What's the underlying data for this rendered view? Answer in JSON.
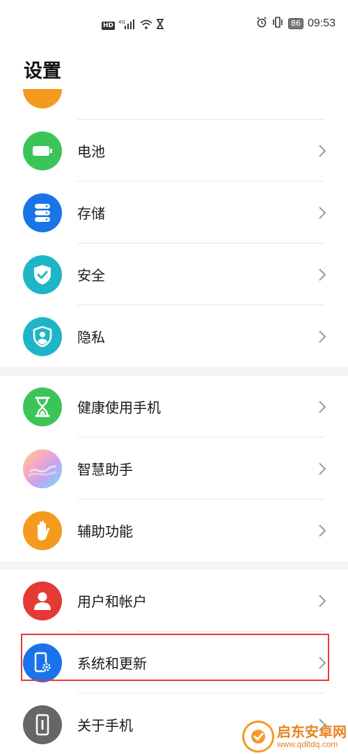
{
  "status_bar": {
    "hd": "HD",
    "network": "4G",
    "battery": "86",
    "time": "09:53"
  },
  "page_title": "设置",
  "items": [
    {
      "label": "",
      "icon": "storage-partial-icon",
      "color": "#f39a1f"
    },
    {
      "label": "电池",
      "icon": "battery-icon",
      "color": "#3dc458"
    },
    {
      "label": "存储",
      "icon": "storage-icon",
      "color": "#1a73e8"
    },
    {
      "label": "安全",
      "icon": "shield-check-icon",
      "color": "#1fb5c8"
    },
    {
      "label": "隐私",
      "icon": "privacy-shield-icon",
      "color": "#1fb5c8"
    },
    {
      "label": "健康使用手机",
      "icon": "hourglass-icon",
      "color": "#3dc458"
    },
    {
      "label": "智慧助手",
      "icon": "assistant-icon",
      "color": "#c9a3ef"
    },
    {
      "label": "辅助功能",
      "icon": "hand-icon",
      "color": "#f39a1f"
    },
    {
      "label": "用户和帐户",
      "icon": "user-icon",
      "color": "#e53935"
    },
    {
      "label": "系统和更新",
      "icon": "system-update-icon",
      "color": "#1a73e8"
    },
    {
      "label": "关于手机",
      "icon": "phone-info-icon",
      "color": "#666666"
    }
  ],
  "watermark": {
    "name": "启东安卓网",
    "url": "www.qdltdq.com"
  }
}
